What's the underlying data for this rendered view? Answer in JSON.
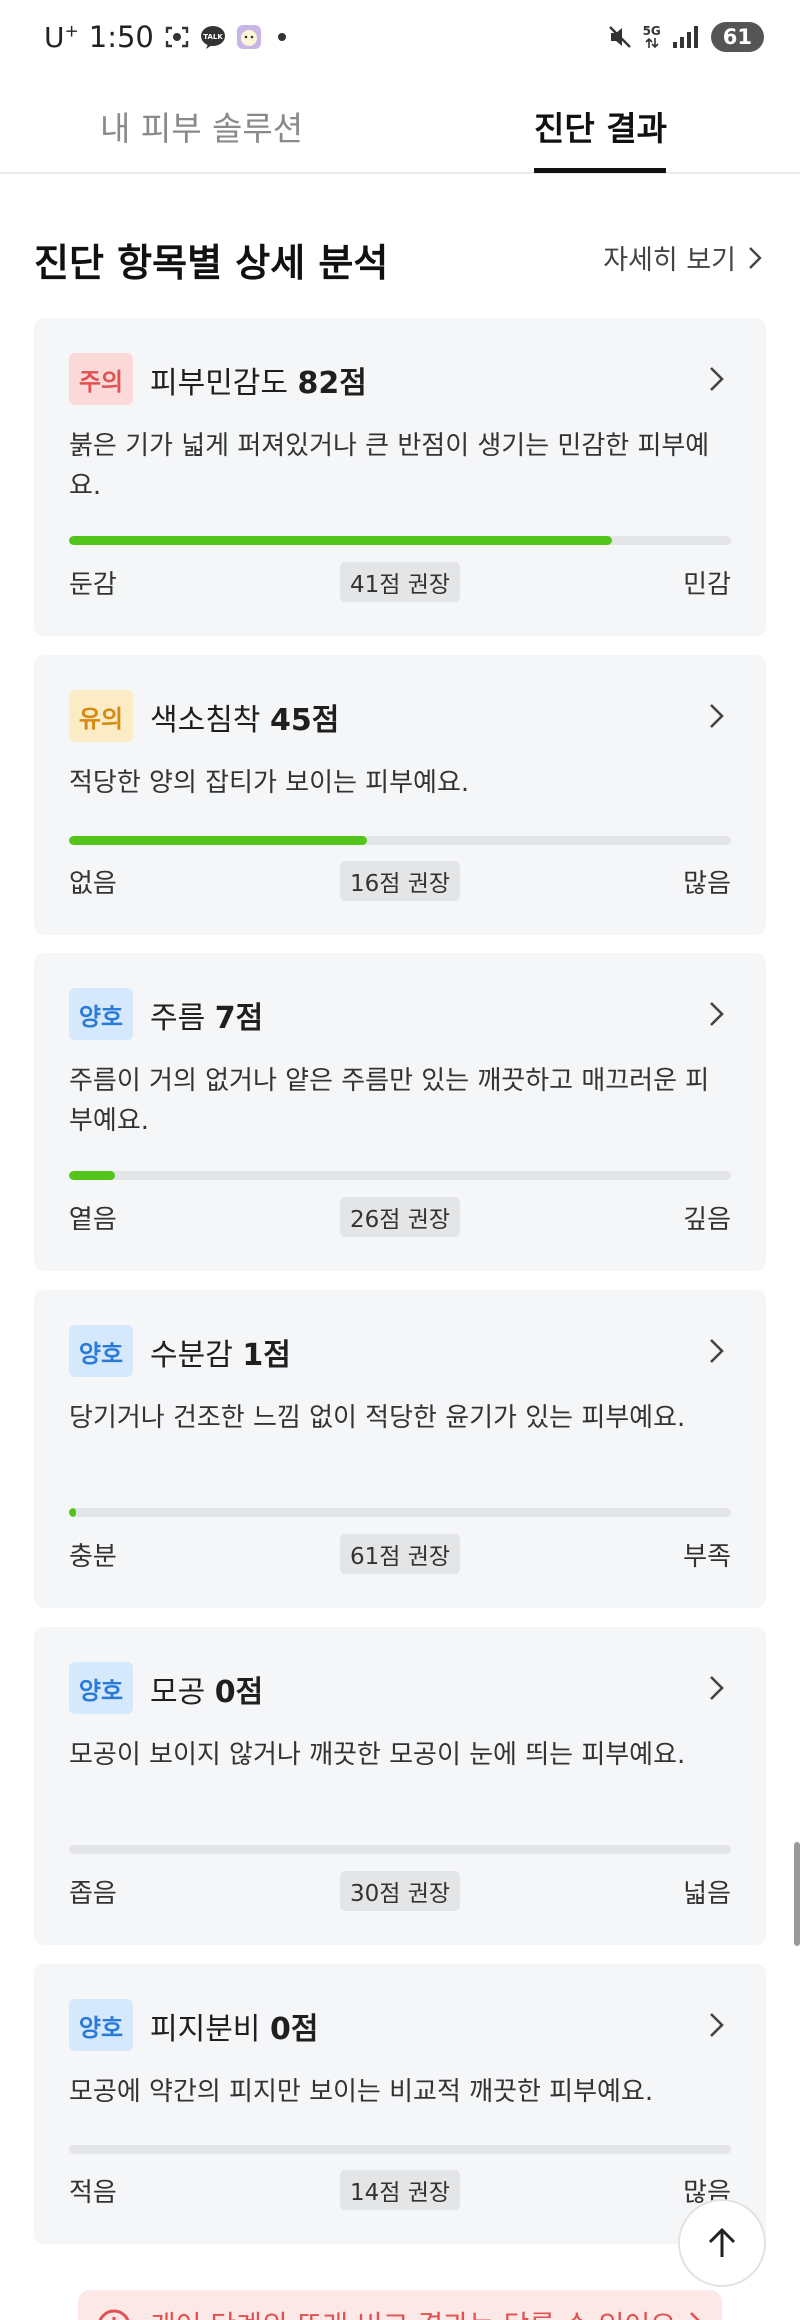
{
  "status_bar": {
    "carrier": "U",
    "carrier_sup": "+",
    "time": "1:50",
    "talk_label": "TALK",
    "network": "5G",
    "battery": "61"
  },
  "tabs": [
    {
      "label": "내 피부 솔루션",
      "active": false
    },
    {
      "label": "진단 결과",
      "active": true
    }
  ],
  "section": {
    "title": "진단 항목별 상세 분석",
    "detail_link": "자세히 보기"
  },
  "cards": [
    {
      "badge": "주의",
      "badge_type": "caution",
      "name": "피부민감도",
      "score": "82점",
      "description": "붉은 기가 넓게 퍼져있거나 큰 반점이 생기는 민감한 피부예요.",
      "progress": 0.82,
      "scale_left": "둔감",
      "recommended": "41점 권장",
      "scale_right": "민감"
    },
    {
      "badge": "유의",
      "badge_type": "notice",
      "name": "색소침착",
      "score": "45점",
      "description": "적당한 양의 잡티가 보이는 피부예요.",
      "progress": 0.45,
      "scale_left": "없음",
      "recommended": "16점 권장",
      "scale_right": "많음"
    },
    {
      "badge": "양호",
      "badge_type": "good",
      "name": "주름",
      "score": "7점",
      "description": "주름이 거의 없거나 얕은 주름만 있는 깨끗하고 매끄러운 피부예요.",
      "progress": 0.07,
      "scale_left": "옅음",
      "recommended": "26점 권장",
      "scale_right": "깊음"
    },
    {
      "badge": "양호",
      "badge_type": "good",
      "name": "수분감",
      "score": "1점",
      "description": "당기거나 건조한 느낌 없이 적당한 윤기가 있는 피부예요.",
      "progress": 0.01,
      "scale_left": "충분",
      "recommended": "61점 권장",
      "scale_right": "부족"
    },
    {
      "badge": "양호",
      "badge_type": "good",
      "name": "모공",
      "score": "0점",
      "description": "모공이 보이지 않거나 깨끗한 모공이 눈에 띄는 피부예요.",
      "progress": 0,
      "scale_left": "좁음",
      "recommended": "30점 권장",
      "scale_right": "넓음"
    },
    {
      "badge": "양호",
      "badge_type": "good",
      "name": "피지분비",
      "score": "0점",
      "description": "모공에 약간의 피지만 보이는 비교적 깨끗한 피부예요.",
      "progress": 0,
      "scale_left": "적음",
      "recommended": "14점 권장",
      "scale_right": "많음"
    }
  ],
  "banner": {
    "text": "케어 단계의 또래 비교 결과는 닫를 수 있어요"
  },
  "colors": {
    "progress": "#52c41a",
    "caution": "#e05252",
    "notice": "#d48a10",
    "good": "#2a7ad8"
  }
}
